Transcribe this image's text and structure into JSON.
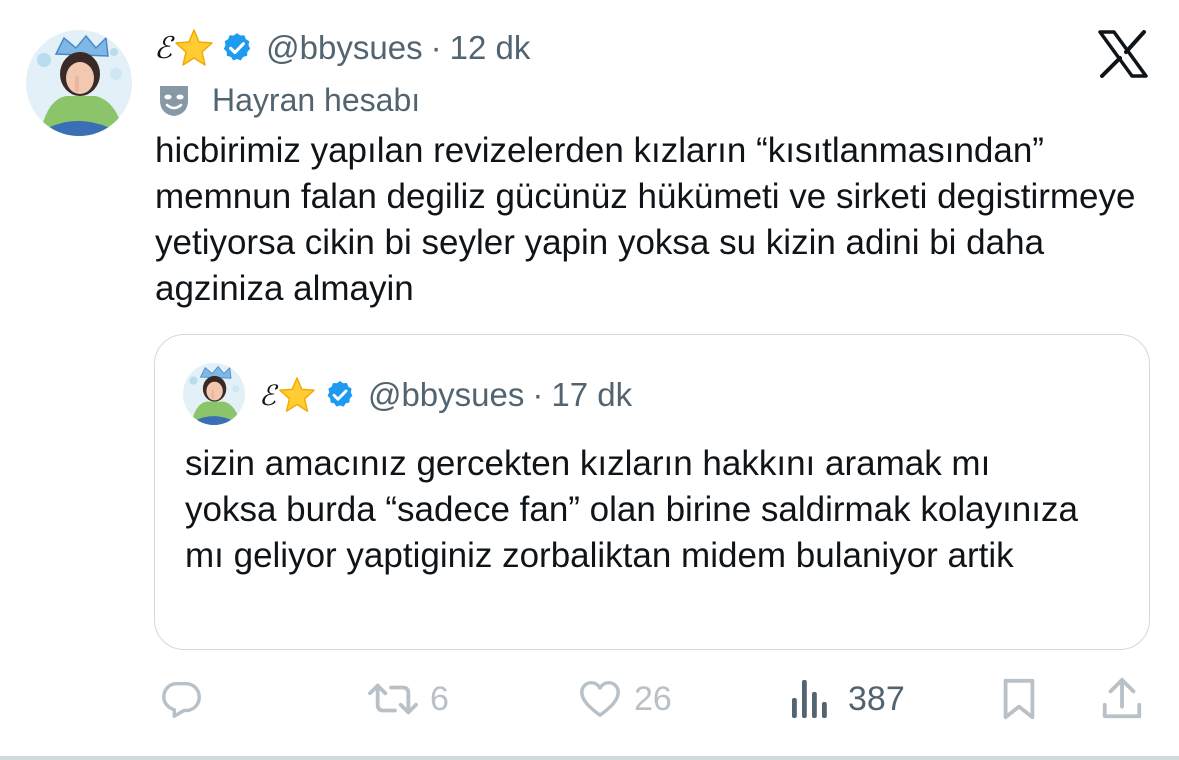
{
  "tweet": {
    "author": {
      "display_name_letter": "ℰ",
      "display_name_emoji": "⭐",
      "verified": true,
      "handle": "@bbysues",
      "separator": "·",
      "time": "12 dk",
      "label_icon": "theater-masks-icon",
      "label": "Hayran hesabı"
    },
    "text": "hicbirimiz yapılan revizelerden kızların “kısıtlanmasından” memnun falan degiliz gücünüz hükümeti ve sirketi degistirmeye yetiyorsa cikin bi seyler yapin yoksa su kizin adini bi daha agziniza almayin",
    "quote": {
      "author": {
        "display_name_letter": "ℰ",
        "display_name_emoji": "⭐",
        "verified": true,
        "handle": "@bbysues",
        "separator": "·",
        "time": "17 dk"
      },
      "text": "sizin amacınız gercekten kızların hakkını aramak mı yoksa burda “sadece fan” olan birine saldirmak kolayınıza mı geliyor yaptiginiz zorbaliktan midem bulaniyor artik"
    },
    "actions": {
      "reply_icon": "reply-icon",
      "retweets": "6",
      "likes": "26",
      "views": "387",
      "bookmark_icon": "bookmark-icon",
      "share_icon": "share-icon"
    }
  },
  "brand_icon": "x-logo-icon",
  "colors": {
    "text": "#0f1419",
    "secondary": "#536471",
    "verified": "#1d9bf0",
    "muted_icon": "#b9c1c8",
    "border": "#cfd9de"
  }
}
